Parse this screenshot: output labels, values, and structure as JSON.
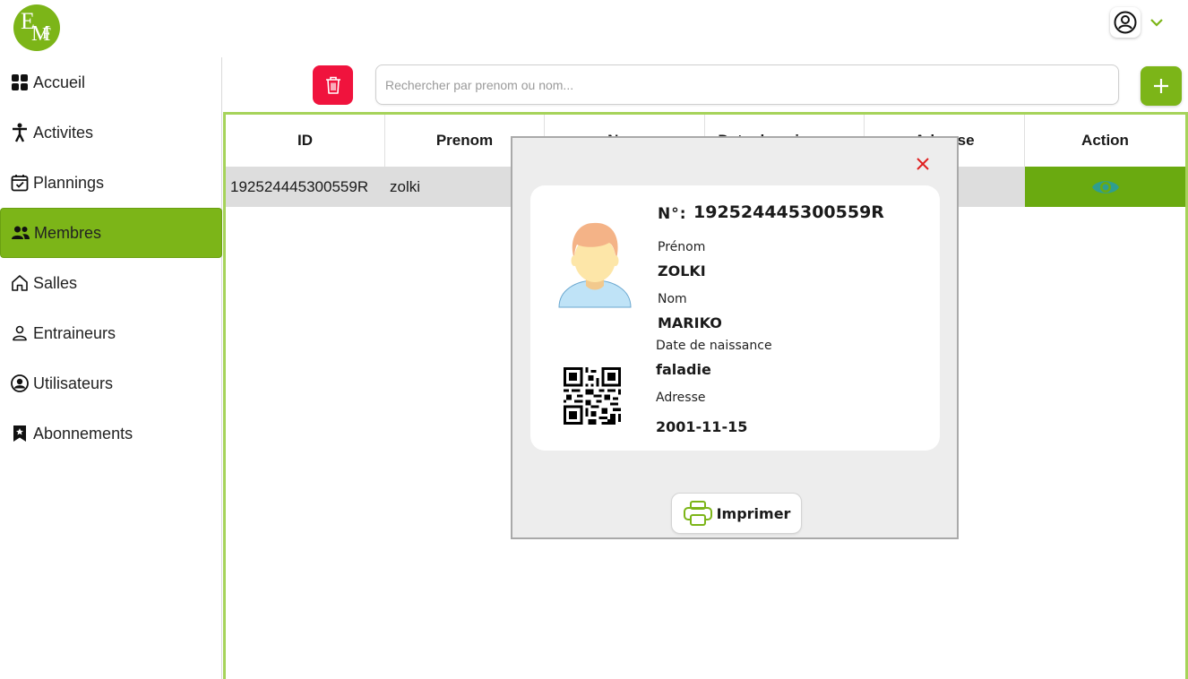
{
  "brand": {
    "logo_letters": [
      "E",
      "M",
      "F"
    ]
  },
  "sidebar": {
    "items": [
      {
        "label": "Accueil",
        "icon": "grid-icon",
        "active": false
      },
      {
        "label": "Activites",
        "icon": "person-activity-icon",
        "active": false
      },
      {
        "label": "Plannings",
        "icon": "calendar-check-icon",
        "active": false
      },
      {
        "label": "Membres",
        "icon": "people-icon",
        "active": true
      },
      {
        "label": "Salles",
        "icon": "home-icon",
        "active": false
      },
      {
        "label": "Entraineurs",
        "icon": "person-outline-icon",
        "active": false
      },
      {
        "label": "Utilisateurs",
        "icon": "user-circle-icon",
        "active": false
      },
      {
        "label": "Abonnements",
        "icon": "bookmark-star-icon",
        "active": false
      }
    ]
  },
  "toolbar": {
    "search_placeholder": "Rechercher par prenom ou nom..."
  },
  "table": {
    "columns": [
      "ID",
      "Prenom",
      "Nom",
      "Date de naissance",
      "Adresse",
      "Action"
    ],
    "rows": [
      {
        "id": "192524445300559R",
        "prenom": "zolki"
      }
    ]
  },
  "modal": {
    "number_label": "N°:",
    "number_value": "192524445300559R",
    "prenom_label": "Prénom",
    "prenom_value": "ZOLKI",
    "nom_label": "Nom",
    "nom_value": "MARIKO",
    "date_label": "Date de naissance",
    "date_value": "faladie",
    "adresse_label": "Adresse",
    "adresse_value": "2001-11-15",
    "print_label": "Imprimer"
  },
  "colors": {
    "accent": "#7cb518",
    "danger": "#f0133d",
    "close": "#e02020"
  }
}
